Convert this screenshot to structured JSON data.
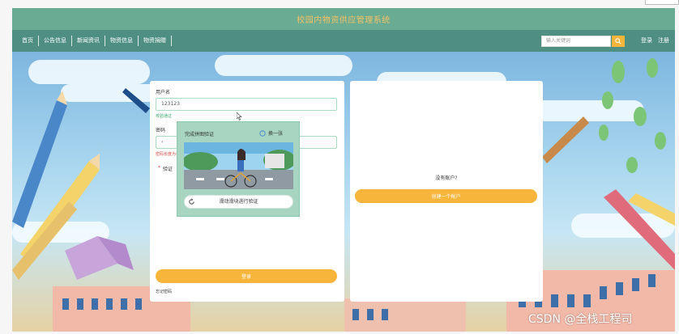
{
  "app": {
    "title": "校园内物资供应管理系统"
  },
  "nav": {
    "items": [
      {
        "label": "首页"
      },
      {
        "label": "公告信息"
      },
      {
        "label": "新闻资讯"
      },
      {
        "label": "物资信息"
      },
      {
        "label": "物资捐赠"
      }
    ],
    "search_placeholder": "输入关键词",
    "login_label": "登录",
    "register_label": "注册"
  },
  "login_form": {
    "username_label": "用户名",
    "username_value": "123123",
    "username_status": "校验通过",
    "password_label": "密码",
    "password_value": "‹",
    "password_error": "密码长度为在5-16个字符",
    "captcha_label": "验证",
    "captcha_required_mark": "*",
    "captcha": {
      "title": "完成拼图验证",
      "refresh_label": "换一张",
      "slider_hint": "滑动滑块进行验证"
    },
    "submit_label": "登录",
    "forgot_label": "忘记密码"
  },
  "register_panel": {
    "prompt": "没有账户?",
    "create_label": "创建一个帐户"
  },
  "watermark": "CSDN @全栈工程司",
  "colors": {
    "title_bar": "#6aab93",
    "nav_bar": "#4f8f82",
    "accent_orange": "#f7b53b",
    "title_text": "#f3c265",
    "ok_green": "#3aa36a",
    "error_red": "#d94a4a"
  },
  "icons": {
    "search": "search-icon",
    "refresh": "refresh-icon",
    "cursor": "mouse-cursor-icon"
  }
}
